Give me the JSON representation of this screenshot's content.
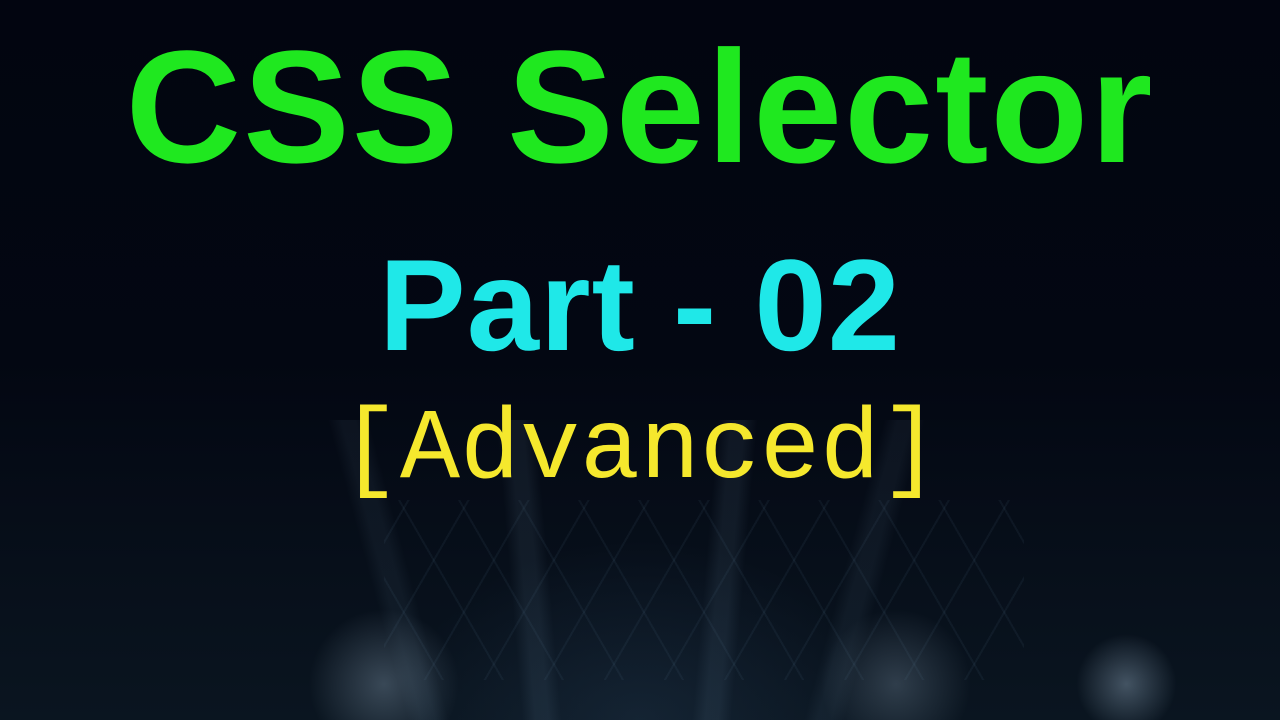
{
  "title": "CSS Selector",
  "part": "Part - 02",
  "level": "[Advanced]",
  "colors": {
    "title": "#1FE81F",
    "part": "#1FE8E8",
    "level": "#F5E82D",
    "background": "#000308"
  }
}
